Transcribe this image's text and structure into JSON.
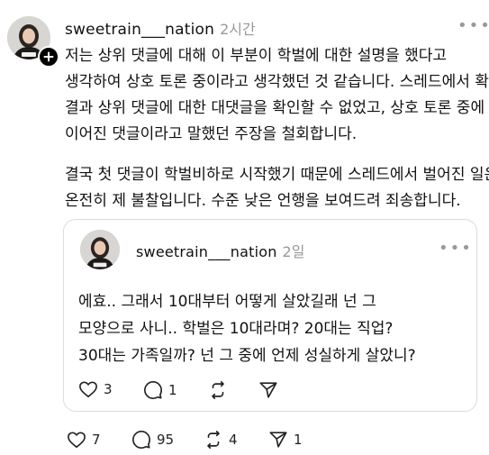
{
  "post": {
    "username": "sweetrain___nation",
    "timestamp": "2시간",
    "more_label": "•••",
    "body_lines": [
      "저는 상위 댓글에 대해 이 부분이 학벌에 대한 설명을 했다고",
      "생각하여 상호 토론 중이라고 생각했던 것 같습니다. 스레드에서 확인",
      "결과 상위 댓글에 대한 대댓글을 확인할 수 없었고,  상호 토론 중에",
      "이어진 댓글이라고 말했던 주장을 철회합니다.",
      "결국 첫 댓글이 학벌비하로 시작했기 때문에 스레드에서 벌어진 일은",
      "온전히 제 불찰입니다. 수준 낮은 언행을 보여드려 죄송합니다."
    ],
    "actions": {
      "likes": "7",
      "comments": "95",
      "reposts": "4",
      "shares": "1"
    }
  },
  "quoted_post": {
    "username": "sweetrain___nation",
    "timestamp": "2일",
    "more_label": "•••",
    "body_lines": [
      "에효.. 그래서 10대부터 어떻게 살았길래 넌 그",
      "모양으로 사니.. 학벌은 10대라며? 20대는 직업?",
      "30대는 가족일까? 넌 그 중에 언제 성실하게 살았니?"
    ],
    "actions": {
      "likes": "3",
      "comments": "1"
    }
  },
  "colors": {
    "text": "#111111",
    "muted": "#999999",
    "border": "#dcdcdc",
    "follow_badge": "#000000"
  }
}
